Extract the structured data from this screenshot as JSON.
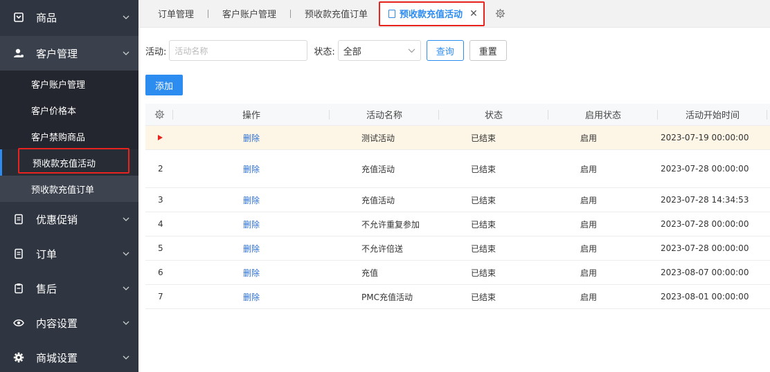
{
  "sidebar": {
    "groups_top": [
      {
        "label": "商品",
        "icon": "box-icon"
      },
      {
        "label": "客户管理",
        "icon": "user-icon"
      }
    ],
    "customer_submenu": [
      {
        "label": "客户账户管理"
      },
      {
        "label": "客户价格本"
      },
      {
        "label": "客户禁购商品"
      },
      {
        "label": "预收款充值活动"
      },
      {
        "label": "预收款充值订单"
      }
    ],
    "groups_bottom": [
      {
        "label": "优惠促销",
        "icon": "doc-icon"
      },
      {
        "label": "订单",
        "icon": "doc-icon"
      },
      {
        "label": "售后",
        "icon": "clipboard-icon"
      },
      {
        "label": "内容设置",
        "icon": "eye-icon"
      },
      {
        "label": "商城设置",
        "icon": "gear-icon"
      }
    ]
  },
  "tabs": {
    "items": [
      "订单管理",
      "客户账户管理",
      "预收款充值订单"
    ],
    "active": "预收款充值活动",
    "close": "✕"
  },
  "filters": {
    "activity_label": "活动:",
    "activity_placeholder": "活动名称",
    "status_label": "状态:",
    "status_value": "全部",
    "query_label": "查询",
    "reset_label": "重置"
  },
  "add_label": "添加",
  "table": {
    "headers": [
      "操作",
      "活动名称",
      "状态",
      "启用状态",
      "活动开始时间"
    ],
    "rows": [
      {
        "index": "",
        "action": "删除",
        "name": "测试活动",
        "status": "已结束",
        "enabled": "启用",
        "start": "2023-07-19 00:00:00"
      },
      {
        "index": "2",
        "action": "删除",
        "name": "充值活动",
        "status": "已结束",
        "enabled": "启用",
        "start": "2023-07-28 00:00:00"
      },
      {
        "index": "3",
        "action": "删除",
        "name": "充值活动",
        "status": "已结束",
        "enabled": "启用",
        "start": "2023-07-28 14:34:53"
      },
      {
        "index": "4",
        "action": "删除",
        "name": "不允许重复参加",
        "status": "已结束",
        "enabled": "启用",
        "start": "2023-07-28 00:00:00"
      },
      {
        "index": "5",
        "action": "删除",
        "name": "不允许倍送",
        "status": "已结束",
        "enabled": "启用",
        "start": "2023-07-28 00:00:00"
      },
      {
        "index": "6",
        "action": "删除",
        "name": "充值",
        "status": "已结束",
        "enabled": "启用",
        "start": "2023-08-07 00:00:00"
      },
      {
        "index": "7",
        "action": "删除",
        "name": "PMC充值活动",
        "status": "已结束",
        "enabled": "启用",
        "start": "2023-08-01 00:00:00"
      }
    ]
  },
  "colors": {
    "sidebar_bg": "#2f3541",
    "accent": "#2d8cf0",
    "highlight_box": "#e8231e",
    "selected_row": "#fdf6e6"
  }
}
